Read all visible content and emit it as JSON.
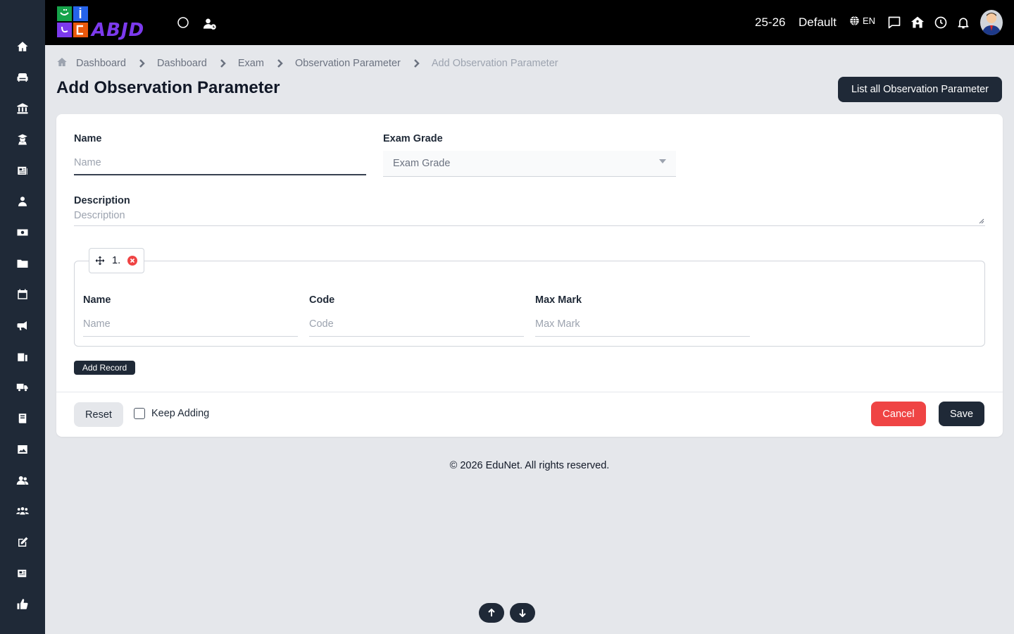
{
  "topbar": {
    "logo_text": "ABJD",
    "session": "25-26",
    "profile": "Default",
    "language": "EN"
  },
  "sidebar": {
    "items": [
      {
        "icon": "home-icon"
      },
      {
        "icon": "sofa-icon"
      },
      {
        "icon": "institution-icon"
      },
      {
        "icon": "graduate-icon"
      },
      {
        "icon": "news-icon"
      },
      {
        "icon": "user-tie-icon"
      },
      {
        "icon": "money-icon"
      },
      {
        "icon": "folder-icon"
      },
      {
        "icon": "calendar-icon"
      },
      {
        "icon": "megaphone-icon"
      },
      {
        "icon": "hospital-icon"
      },
      {
        "icon": "truck-icon"
      },
      {
        "icon": "book-icon"
      },
      {
        "icon": "image-icon"
      },
      {
        "icon": "users-icon"
      },
      {
        "icon": "people-group-icon"
      },
      {
        "icon": "edit-icon"
      },
      {
        "icon": "newspaper-icon"
      },
      {
        "icon": "thumbs-up-icon"
      }
    ]
  },
  "breadcrumb": {
    "items": [
      "Dashboard",
      "Dashboard",
      "Exam",
      "Observation Parameter"
    ],
    "current": "Add Observation Parameter"
  },
  "page": {
    "title": "Add Observation Parameter",
    "list_button": "List all Observation Parameter"
  },
  "form": {
    "name_label": "Name",
    "name_placeholder": "Name",
    "exam_grade_label": "Exam Grade",
    "exam_grade_placeholder": "Exam Grade",
    "description_label": "Description",
    "description_placeholder": "Description",
    "record": {
      "index": "1.",
      "name_label": "Name",
      "name_placeholder": "Name",
      "code_label": "Code",
      "code_placeholder": "Code",
      "max_mark_label": "Max Mark",
      "max_mark_placeholder": "Max Mark"
    },
    "add_record": "Add Record",
    "reset": "Reset",
    "keep_adding": "Keep Adding",
    "cancel": "Cancel",
    "save": "Save"
  },
  "footer": {
    "copyright": "© 2026 EduNet. All rights reserved."
  },
  "colors": {
    "dark": "#1f2937",
    "danger": "#ef4444",
    "topbar": "#000000"
  }
}
